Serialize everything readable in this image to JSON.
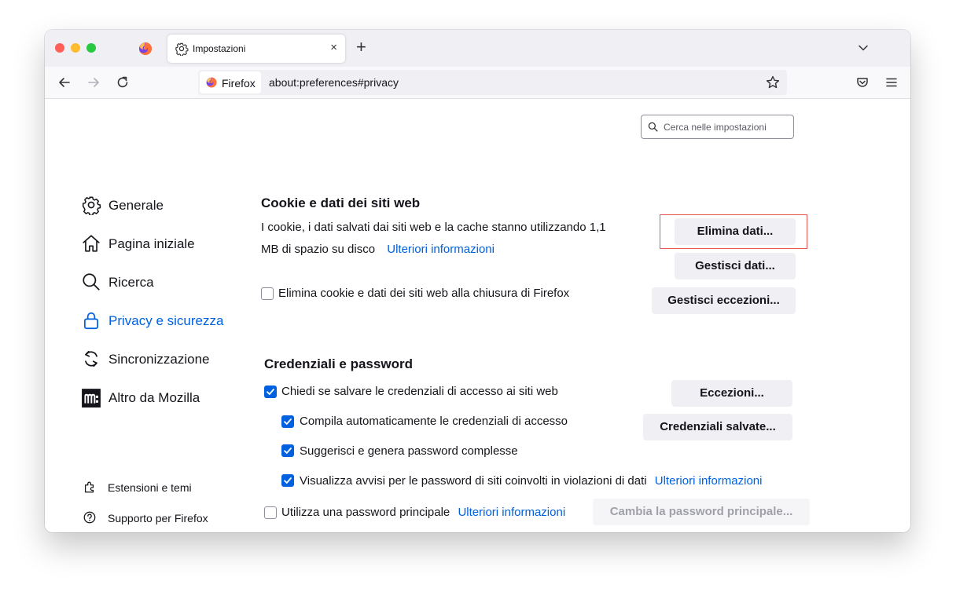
{
  "browser": {
    "tab_title": "Impostazioni",
    "tab_close": "×",
    "new_tab": "+",
    "identity_label": "Firefox",
    "url": "about:preferences#privacy"
  },
  "search": {
    "placeholder": "Cerca nelle impostazioni"
  },
  "sidebar": {
    "categories": [
      {
        "label": "Generale",
        "icon": "gear-icon"
      },
      {
        "label": "Pagina iniziale",
        "icon": "home-icon"
      },
      {
        "label": "Ricerca",
        "icon": "search-icon"
      },
      {
        "label": "Privacy e sicurezza",
        "icon": "lock-icon",
        "active": true
      },
      {
        "label": "Sincronizzazione",
        "icon": "sync-icon"
      },
      {
        "label": "Altro da Mozilla",
        "icon": "mozilla-icon"
      }
    ],
    "footer": [
      {
        "label": "Estensioni e temi",
        "icon": "puzzle-icon"
      },
      {
        "label": "Supporto per Firefox",
        "icon": "help-icon"
      }
    ]
  },
  "cookies": {
    "title": "Cookie e dati dei siti web",
    "desc_line1": "I cookie, i dati salvati dai siti web e la cache stanno utilizzando 1,1",
    "desc_line2": "MB di spazio su disco",
    "learn_more": "Ulteriori informazioni",
    "clear_button": "Elimina dati...",
    "manage_button": "Gestisci dati...",
    "exceptions_button": "Gestisci eccezioni...",
    "delete_on_close_label": "Elimina cookie e dati dei siti web alla chiusura di Firefox",
    "delete_on_close_checked": false
  },
  "passwords": {
    "title": "Credenziali e password",
    "ask_save_label": "Chiedi se salvare le credenziali di accesso ai siti web",
    "ask_save_checked": true,
    "autofill_label": "Compila automaticamente le credenziali di accesso",
    "autofill_checked": true,
    "suggest_label": "Suggerisci e genera password complesse",
    "suggest_checked": true,
    "breach_label": "Visualizza avvisi per le password di siti coinvolti in violazioni di dati",
    "breach_checked": true,
    "breach_learn_more": "Ulteriori informazioni",
    "primary_label": "Utilizza una password principale",
    "primary_checked": false,
    "primary_learn_more": "Ulteriori informazioni",
    "exceptions_button": "Eccezioni...",
    "saved_logins_button": "Credenziali salvate...",
    "change_primary_button": "Cambia la password principale..."
  },
  "colors": {
    "accent": "#0061e0",
    "highlight": "#e8574d"
  }
}
